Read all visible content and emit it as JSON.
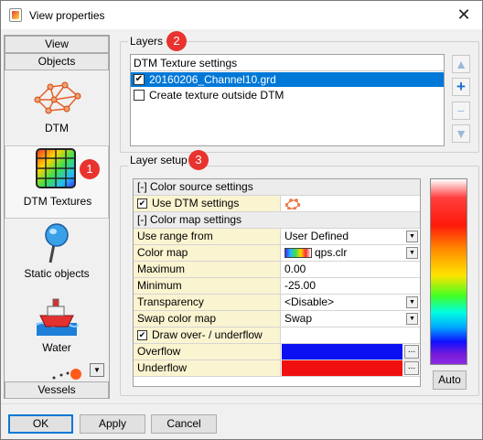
{
  "window": {
    "title": "View properties",
    "close_glyph": "✕"
  },
  "left_panel": {
    "top_buttons": [
      "View",
      "Objects"
    ],
    "bottom_button": "Vessels",
    "items": [
      {
        "label": "DTM",
        "icon": "dtm-icon"
      },
      {
        "label": "DTM Textures",
        "icon": "dtm-textures-icon",
        "selected": true
      },
      {
        "label": "Static objects",
        "icon": "static-objects-icon"
      },
      {
        "label": "Water",
        "icon": "water-icon"
      }
    ],
    "scroll_glyph": "▼"
  },
  "badges": [
    "1",
    "2",
    "3"
  ],
  "layers": {
    "group_title": "Layers",
    "header": "DTM Texture settings",
    "rows": [
      {
        "label": "20160206_Channel10.grd",
        "checked": true,
        "selected": true
      },
      {
        "label": "Create texture outside DTM",
        "checked": false,
        "selected": false
      }
    ],
    "side_buttons": [
      "▲",
      "+",
      "−",
      "▼"
    ]
  },
  "layer_setup": {
    "group_title": "Layer setup",
    "rows": [
      {
        "type": "section",
        "name": "[-] Color source settings"
      },
      {
        "type": "check",
        "name": "Use DTM settings",
        "checked": true,
        "value_icon": "dtm-grid-icon"
      },
      {
        "type": "section",
        "name": "[-] Color map settings"
      },
      {
        "type": "dropdown",
        "name": "Use range from",
        "value": "User Defined"
      },
      {
        "type": "colormap",
        "name": "Color map",
        "value": "qps.clr"
      },
      {
        "type": "text",
        "name": "Maximum",
        "value": "0.00"
      },
      {
        "type": "text",
        "name": "Minimum",
        "value": "-25.00"
      },
      {
        "type": "dropdown",
        "name": "Transparency",
        "value": "<Disable>"
      },
      {
        "type": "dropdown",
        "name": "Swap color map",
        "value": "Swap"
      },
      {
        "type": "check",
        "name": "Draw over- / underflow",
        "checked": true
      },
      {
        "type": "color",
        "name": "Overflow",
        "color": "#0a10f0"
      },
      {
        "type": "color",
        "name": "Underflow",
        "color": "#f01010"
      }
    ],
    "auto_button": "Auto"
  },
  "footer": {
    "ok": "OK",
    "apply": "Apply",
    "cancel": "Cancel"
  },
  "colors": {
    "accent": "#0078d7",
    "badge": "#e8332e",
    "property_name_bg": "#fbf4d0"
  }
}
